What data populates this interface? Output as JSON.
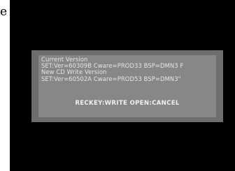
{
  "page": {
    "edge_text": "e"
  },
  "dialog": {
    "lines": [
      "Current Version",
      "SET:Ver=60309B Cware=PROD33 BSP=DMN3 F",
      "New CD Write Version",
      "SET:Ver=60502A Cware=PROD53 BSP=DMN3\""
    ],
    "action_hint": "RECKEY:WRITE OPEN:CANCEL"
  },
  "colors": {
    "screen_background": "#000000",
    "dialog_outer": "#6d6d6d",
    "dialog_inner": "#878787",
    "text": "#e6e6e6"
  }
}
